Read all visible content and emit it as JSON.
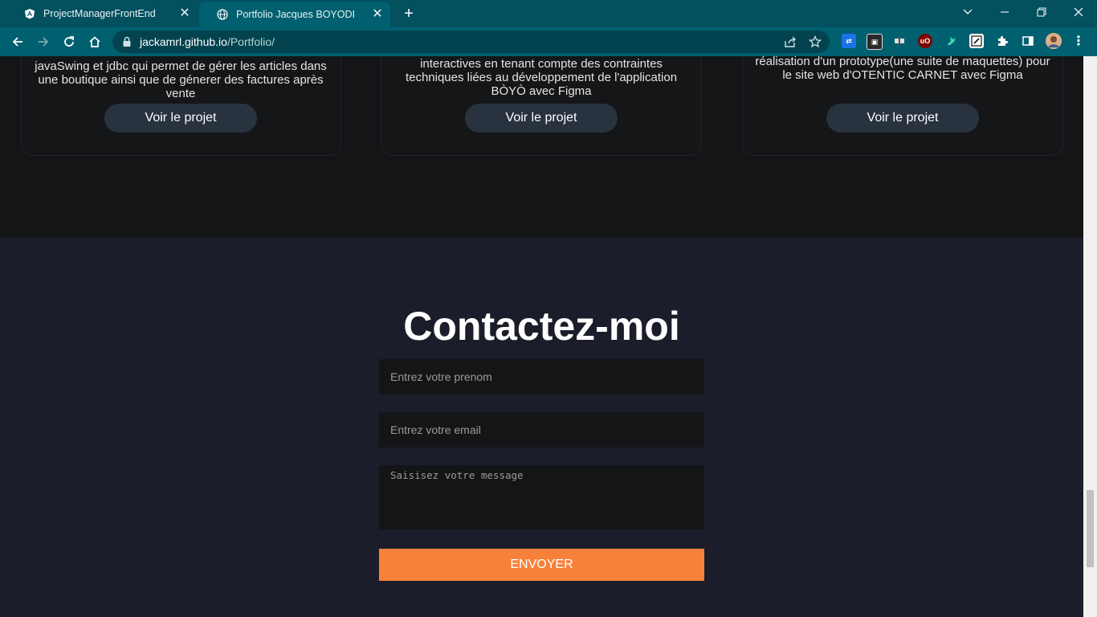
{
  "browser": {
    "tabs": [
      {
        "title": "ProjectManagerFrontEnd",
        "favicon": "angular-icon",
        "active": false
      },
      {
        "title": "Portfolio Jacques BOYODI",
        "favicon": "globe-icon",
        "active": true
      }
    ],
    "url_host": "jackamrl.github.io",
    "url_path": "/Portfolio/",
    "extensions": [
      "translate-icon",
      "screenshot-icon",
      "gear-mask-icon",
      "ublock-icon",
      "bird-icon",
      "notion-icon",
      "puzzle-icon"
    ]
  },
  "projects": {
    "cards": [
      {
        "lines": [
          "javaSwing et jdbc qui permet de gérer les articles dans",
          "une boutique ainsi que de génerer des factures après",
          "vente"
        ],
        "button": "Voir le projet"
      },
      {
        "lines": [
          "interactives en tenant compte des contraintes",
          "techniques liées au développement de l'application",
          "BÒYÒ avec Figma"
        ],
        "button": "Voir le projet"
      },
      {
        "lines": [
          "réalisation d'un prototype(une suite de maquettes) pour",
          "le site web d'OTENTIC CARNET avec Figma"
        ],
        "button": "Voir le projet"
      }
    ]
  },
  "contact": {
    "title": "Contactez-moi",
    "firstname_placeholder": "Entrez votre prenom",
    "email_placeholder": "Entrez votre email",
    "message_placeholder": "Saisisez votre message",
    "submit": "ENVOYER"
  },
  "colors": {
    "chrome_tabbar": "#03505f",
    "chrome_toolbar": "#00606f",
    "page_bg": "#1b1d2a",
    "accent": "#f8813a"
  }
}
